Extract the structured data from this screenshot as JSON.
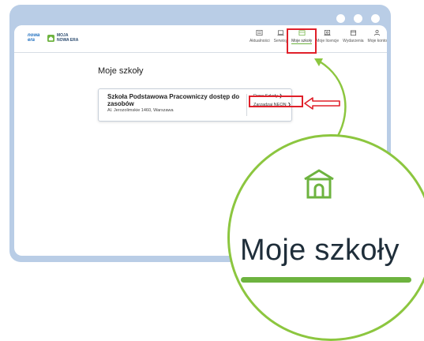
{
  "logo": {
    "nowa_era": [
      "nowa",
      "era"
    ],
    "moja_nowa_era": [
      "MOJA",
      "NOWA ERA"
    ]
  },
  "nav": [
    {
      "label": "Aktualności",
      "icon": "news-icon"
    },
    {
      "label": "Serwisy",
      "icon": "laptop-icon"
    },
    {
      "label": "Moje szkoły",
      "icon": "school-icon",
      "active": true
    },
    {
      "label": "Moje licencje",
      "icon": "license-icon"
    },
    {
      "label": "Wydarzenia",
      "icon": "calendar-icon"
    },
    {
      "label": "Moje konto",
      "icon": "user-icon"
    }
  ],
  "page": {
    "title": "Moje szkoły",
    "school": {
      "name": "Szkoła Podstawowa Pracowniczy dostęp do zasobów",
      "address": "Al. Jerozolimskie 1460, Warszawa",
      "link_details": "Dane Szkoły",
      "link_manage": "Zarządzaj NEON"
    }
  },
  "zoom": {
    "label": "Moje szkoły"
  },
  "colors": {
    "accent_green": "#6db33f",
    "highlight_red": "#e0202a",
    "frame_blue": "#b9cde6"
  }
}
